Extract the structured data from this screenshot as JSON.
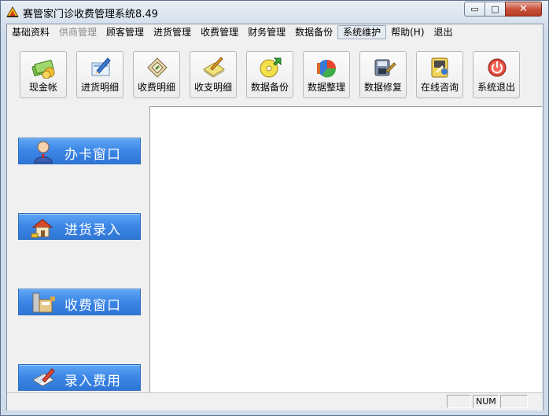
{
  "window": {
    "title": "赛管家门诊收费管理系统8.49",
    "min_glyph": "▭",
    "max_glyph": "□",
    "close_glyph": "✕"
  },
  "menu": [
    {
      "label": "基础资料",
      "state": "normal"
    },
    {
      "label": "供商管理",
      "state": "disabled"
    },
    {
      "label": "顾客管理",
      "state": "normal"
    },
    {
      "label": "进货管理",
      "state": "normal"
    },
    {
      "label": "收费管理",
      "state": "normal"
    },
    {
      "label": "财务管理",
      "state": "normal"
    },
    {
      "label": "数据备份",
      "state": "normal"
    },
    {
      "label": "系统维护",
      "state": "active"
    },
    {
      "label": "帮助(H)",
      "state": "normal"
    },
    {
      "label": "退出",
      "state": "normal"
    }
  ],
  "toolbar": [
    {
      "label": "现金帐",
      "icon": "cash-icon"
    },
    {
      "label": "进货明细",
      "icon": "purchase-detail-icon"
    },
    {
      "label": "收费明细",
      "icon": "charge-detail-icon"
    },
    {
      "label": "收支明细",
      "icon": "income-expense-icon"
    },
    {
      "label": "数据备份",
      "icon": "backup-disc-icon"
    },
    {
      "label": "数据整理",
      "icon": "data-chart-icon"
    },
    {
      "label": "数据修复",
      "icon": "repair-tool-icon"
    },
    {
      "label": "在线咨询",
      "icon": "online-consult-icon"
    },
    {
      "label": "系统退出",
      "icon": "power-icon"
    }
  ],
  "sidebar": [
    {
      "label": "办卡窗口",
      "icon": "person-icon"
    },
    {
      "label": "进货录入",
      "icon": "house-icon"
    },
    {
      "label": "收费窗口",
      "icon": "cash-register-icon"
    },
    {
      "label": "录入费用",
      "icon": "edit-form-icon"
    }
  ],
  "status": {
    "num": "NUM"
  },
  "colors": {
    "sidebar_button": "#3b86e6",
    "close_button": "#c8513c"
  }
}
